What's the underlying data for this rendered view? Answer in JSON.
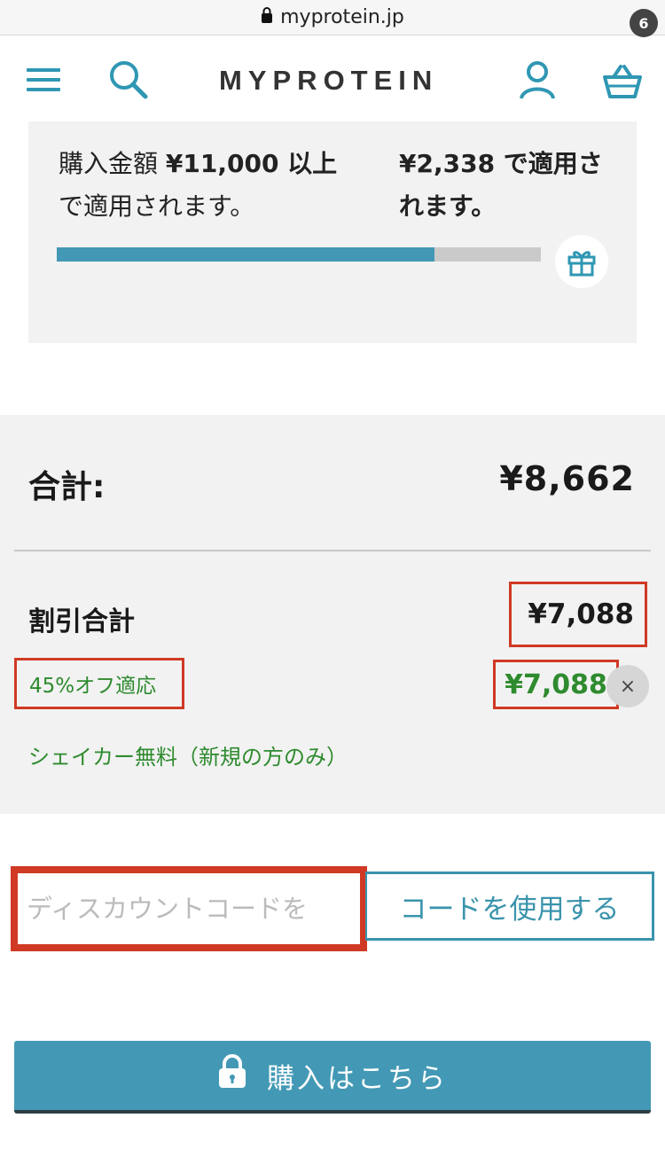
{
  "browser": {
    "url": "myprotein.jp"
  },
  "header": {
    "logo": "MYPROTEIN",
    "basket_count": "6"
  },
  "free_gift": {
    "line1_prefix": "購入金額 ",
    "threshold": "¥11,000 以上",
    "line1_suffix": "で適用されます。",
    "remaining": "¥2,338 で適用されます。",
    "progress_fraction": 0.78
  },
  "totals": {
    "total_label": "合計:",
    "total_value": "¥8,662",
    "discount_label": "割引合計",
    "discount_value": "¥7,088",
    "promo_label": "45%オフ適応",
    "promo_value": "¥7,088",
    "remove_symbol": "×",
    "shaker_text": "シェイカー無料（新規の方のみ）"
  },
  "discount_code": {
    "placeholder": "ディスカウントコードを",
    "button_label": "コードを使用する"
  },
  "checkout": {
    "label": "購入はこちら"
  },
  "colors": {
    "accent": "#4399b5",
    "highlight": "#d03a24",
    "promo_green": "#2e8b2e"
  }
}
